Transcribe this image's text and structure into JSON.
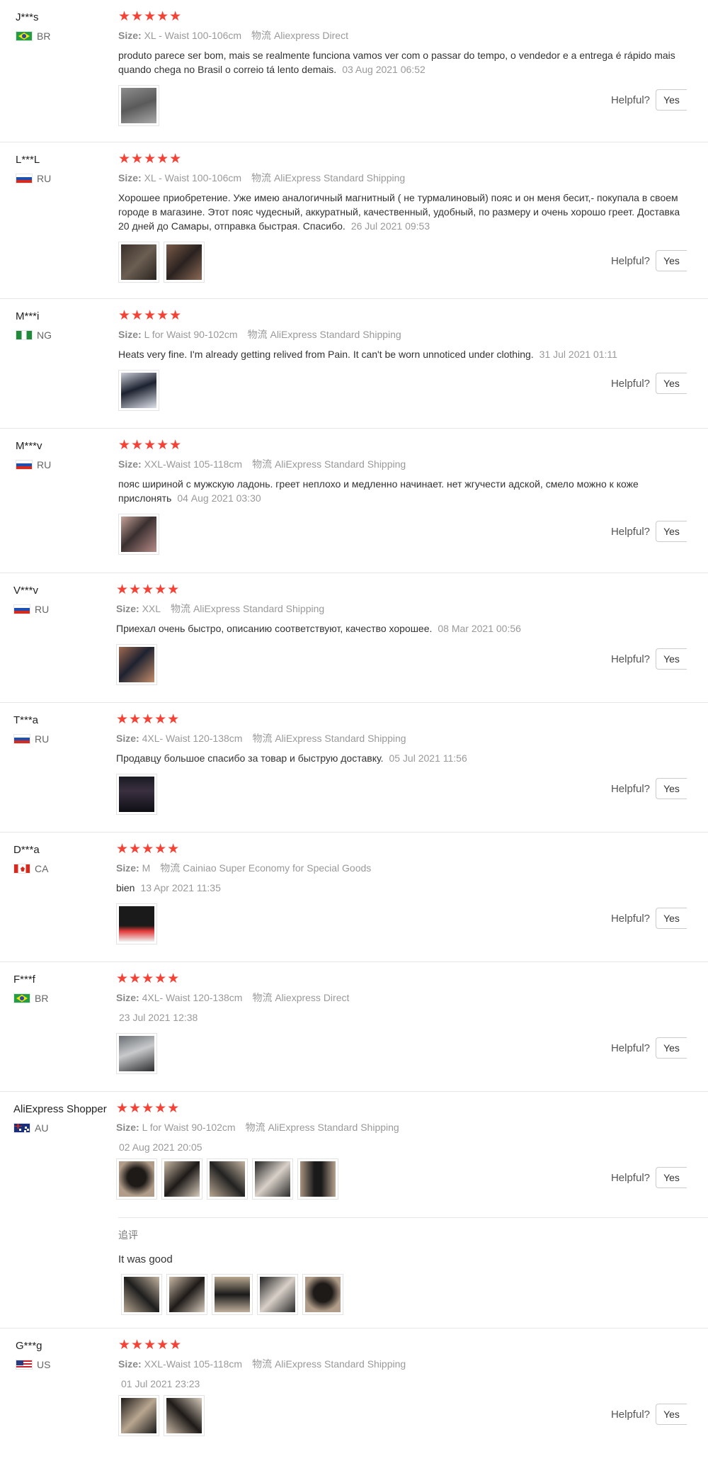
{
  "helpful_label": "Helpful?",
  "yes_label": "Yes",
  "size_label": "Size:",
  "logistics_label": "物流",
  "stars": "★★★★★",
  "reviews": [
    {
      "user": "J***s",
      "country": "BR",
      "size": "XL - Waist 100-106cm",
      "shipping": "Aliexpress Direct",
      "text": "produto parece ser bom, mais se realmente funciona vamos ver com o passar do tempo, o vendedor e a entrega é rápido mais quando chega no Brasil o correio tá lento demais.",
      "date": "03 Aug 2021 06:52"
    },
    {
      "user": "L***L",
      "country": "RU",
      "size": "XL - Waist 100-106cm",
      "shipping": "AliExpress Standard Shipping",
      "text": "Хорошее приобретение. Уже имею аналогичный магнитный ( не турмалиновый) пояс и он меня бесит,- покупала в своем городе в магазине. Этот пояс чудесный, аккуратный, качественный, удобный, по размеру и очень хорошо греет. Доставка 20 дней до Самары, отправка быстрая. Спасибо.",
      "date": "26 Jul 2021 09:53"
    },
    {
      "user": "M***i",
      "country": "NG",
      "size": "L for Waist 90-102cm",
      "shipping": "AliExpress Standard Shipping",
      "text": "Heats very fine. I'm already getting relived from Pain. It can't be worn unnoticed under clothing.",
      "date": "31 Jul 2021 01:11"
    },
    {
      "user": "M***v",
      "country": "RU",
      "size": "XXL-Waist 105-118cm",
      "shipping": "AliExpress Standard Shipping",
      "text": "пояс шириной с мужскую ладонь. греет неплохо и медленно начинает. нет жгучести адской, смело можно к коже прислонять",
      "date": "04 Aug 2021 03:30"
    },
    {
      "user": "V***v",
      "country": "RU",
      "size": "XXL",
      "shipping": "AliExpress Standard Shipping",
      "text": "Приехал очень быстро, описанию соответствуют, качество хорошее.",
      "date": "08 Mar 2021 00:56"
    },
    {
      "user": "T***a",
      "country": "RU",
      "size": "4XL- Waist 120-138cm",
      "shipping": "AliExpress Standard Shipping",
      "text": "Продавцу большое спасибо за товар и быструю доставку.",
      "date": "05 Jul 2021 11:56"
    },
    {
      "user": "D***a",
      "country": "CA",
      "size": "M",
      "shipping": "Cainiao Super Economy for Special Goods",
      "text": "bien",
      "date": "13 Apr 2021 11:35"
    },
    {
      "user": "F***f",
      "country": "BR",
      "size": "4XL- Waist 120-138cm",
      "shipping": "Aliexpress Direct",
      "text": "",
      "date": "23 Jul 2021 12:38"
    },
    {
      "user": "AliExpress Shopper",
      "country": "AU",
      "size": "L for Waist 90-102cm",
      "shipping": "AliExpress Standard Shipping",
      "text": "",
      "date": "02 Aug 2021 20:05",
      "additional_label": "追评",
      "additional_text": "It was good"
    },
    {
      "user": "G***g",
      "country": "US",
      "size": "XXL-Waist 105-118cm",
      "shipping": "AliExpress Standard Shipping",
      "text": "",
      "date": "01 Jul 2021 23:23"
    }
  ]
}
